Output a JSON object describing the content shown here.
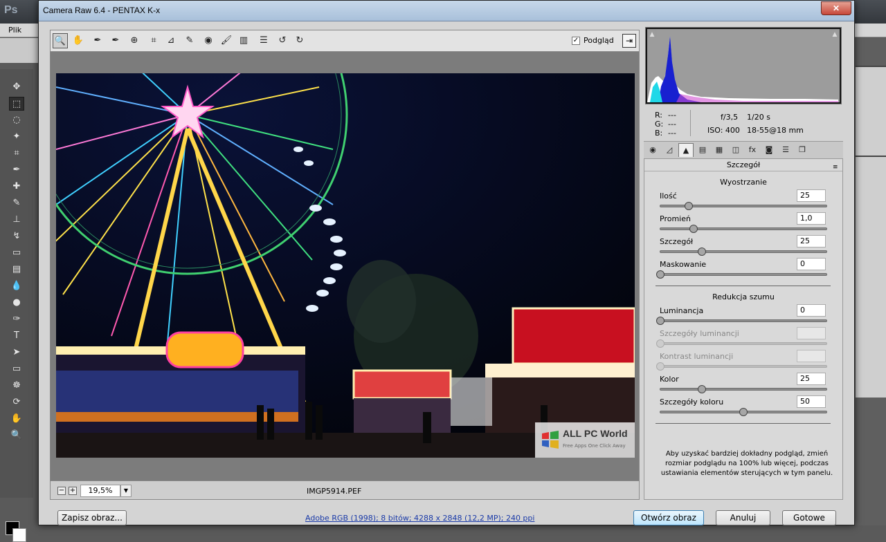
{
  "ps": {
    "logo": "Ps",
    "menu_file": "Plik"
  },
  "dialog": {
    "title": "Camera Raw 6.4  -  PENTAX K-x",
    "close_glyph": "✕"
  },
  "toolbar": {
    "tools": [
      {
        "name": "zoom-tool",
        "icon": "🔍"
      },
      {
        "name": "hand-tool",
        "icon": "✋"
      },
      {
        "name": "white-balance-tool",
        "icon": "✒"
      },
      {
        "name": "color-sampler-tool",
        "icon": "✒"
      },
      {
        "name": "targeted-adjustment-tool",
        "icon": "⊕"
      },
      {
        "name": "crop-tool",
        "icon": "⌗"
      },
      {
        "name": "straighten-tool",
        "icon": "⊿"
      },
      {
        "name": "spot-removal-tool",
        "icon": "✎"
      },
      {
        "name": "red-eye-tool",
        "icon": "◉"
      },
      {
        "name": "adjustment-brush",
        "icon": "🖌"
      },
      {
        "name": "graduated-filter",
        "icon": "▥"
      },
      {
        "name": "preferences",
        "icon": "☰"
      },
      {
        "name": "rotate-left",
        "icon": "↺"
      },
      {
        "name": "rotate-right",
        "icon": "↻"
      }
    ],
    "preview_checked": true,
    "preview_label": "Podgląd",
    "fullscreen_icon": "⇥"
  },
  "status": {
    "zoom_value": "19,5%",
    "filename": "IMGP5914.PEF"
  },
  "watermark": {
    "title": "ALL PC World",
    "subtitle": "Free Apps One Click Away"
  },
  "readout": {
    "r_label": "R:",
    "r_value": "---",
    "g_label": "G:",
    "g_value": "---",
    "b_label": "B:",
    "b_value": "---",
    "aperture": "f/3,5",
    "shutter": "1/20 s",
    "iso": "ISO: 400",
    "lens": "18-55@18 mm"
  },
  "panel": {
    "header": "Szczegół",
    "menu_icon": "≡",
    "tabs": [
      {
        "name": "tab-basic",
        "icon": "◉"
      },
      {
        "name": "tab-tone-curve",
        "icon": "◿"
      },
      {
        "name": "tab-detail",
        "icon": "▲"
      },
      {
        "name": "tab-hsl",
        "icon": "▤"
      },
      {
        "name": "tab-split-toning",
        "icon": "▦"
      },
      {
        "name": "tab-lens-corrections",
        "icon": "◫"
      },
      {
        "name": "tab-effects",
        "icon": "fx"
      },
      {
        "name": "tab-camera-calibration",
        "icon": "◙"
      },
      {
        "name": "tab-presets",
        "icon": "☰"
      },
      {
        "name": "tab-snapshots",
        "icon": "❐"
      }
    ],
    "sharpening": {
      "title": "Wyostrzanie",
      "sliders": [
        {
          "label": "Ilość",
          "value": "25",
          "pos": 0.17
        },
        {
          "label": "Promień",
          "value": "1,0",
          "pos": 0.2
        },
        {
          "label": "Szczegół",
          "value": "25",
          "pos": 0.25
        },
        {
          "label": "Maskowanie",
          "value": "0",
          "pos": 0.0
        }
      ]
    },
    "noise": {
      "title": "Redukcja szumu",
      "sliders": [
        {
          "label": "Luminancja",
          "value": "0",
          "pos": 0.0,
          "dim": false
        },
        {
          "label": "Szczegóły luminancji",
          "value": "",
          "pos": 0.0,
          "dim": true
        },
        {
          "label": "Kontrast luminancji",
          "value": "",
          "pos": 0.0,
          "dim": true
        },
        {
          "label": "Kolor",
          "value": "25",
          "pos": 0.25,
          "dim": false
        },
        {
          "label": "Szczegóły koloru",
          "value": "50",
          "pos": 0.5,
          "dim": false
        }
      ]
    },
    "hint": "Aby uzyskać bardziej dokładny podgląd, zmień rozmiar podglądu na 100% lub więcej, podczas ustawiania elementów sterujących w tym panelu."
  },
  "buttons": {
    "save": "Zapisz obraz...",
    "open": "Otwórz obraz",
    "cancel": "Anuluj",
    "done": "Gotowe"
  },
  "workflow_link": "Adobe RGB (1998); 8 bitów; 4288 x 2848 (12,2 MP); 240 ppi",
  "colors": {
    "accent_blue": "#3c7fb1",
    "link_blue": "#1a3aa8"
  }
}
